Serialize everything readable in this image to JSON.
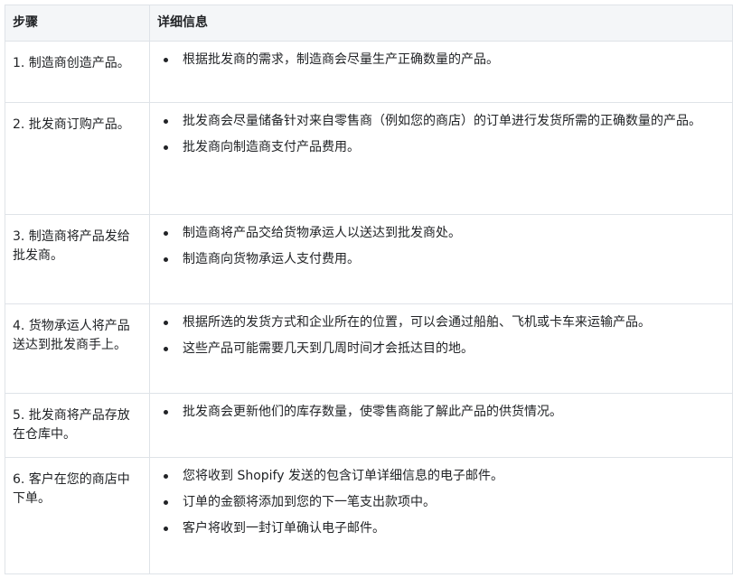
{
  "headers": {
    "step": "步骤",
    "detail": "详细信息"
  },
  "rows": [
    {
      "step": "1. 制造商创造产品。",
      "details": [
        "根据批发商的需求，制造商会尽量生产正确数量的产品。"
      ]
    },
    {
      "step": "2. 批发商订购产品。",
      "details": [
        "批发商会尽量储备针对来自零售商（例如您的商店）的订单进行发货所需的正确数量的产品。",
        "批发商向制造商支付产品费用。"
      ]
    },
    {
      "step": "3. 制造商将产品发给批发商。",
      "details": [
        "制造商将产品交给货物承运人以送达到批发商处。",
        "制造商向货物承运人支付费用。"
      ]
    },
    {
      "step": "4. 货物承运人将产品送达到批发商手上。",
      "details": [
        "根据所选的发货方式和企业所在的位置，可以会通过船舶、飞机或卡车来运输产品。",
        "这些产品可能需要几天到几周时间才会抵达目的地。"
      ]
    },
    {
      "step": "5. 批发商将产品存放在仓库中。",
      "details": [
        "批发商会更新他们的库存数量，使零售商能了解此产品的供货情况。"
      ]
    },
    {
      "step": "6. 客户在您的商店中下单。",
      "details": [
        "您将收到 Shopify 发送的包含订单详细信息的电子邮件。",
        "订单的金额将添加到您的下一笔支出款项中。",
        "客户将收到一封订单确认电子邮件。"
      ]
    }
  ]
}
